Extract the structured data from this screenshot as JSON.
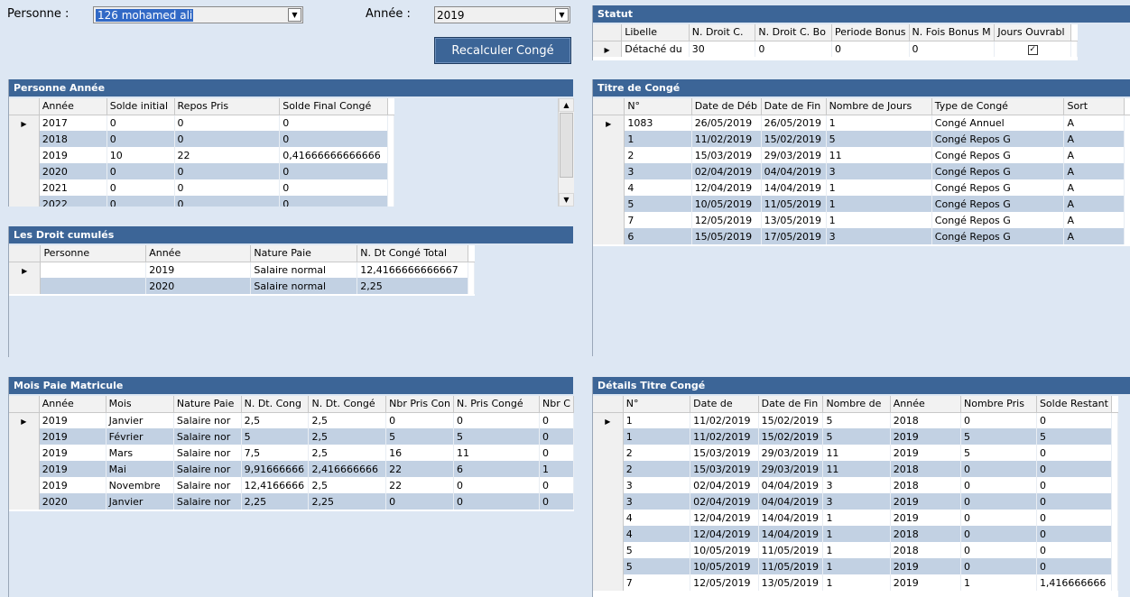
{
  "filters": {
    "personne_label": "Personne :",
    "personne_value": "126 mohamed ali",
    "annee_label": "Année :",
    "annee_value": "2019",
    "recalc_label": "Recalculer Congé"
  },
  "statut": {
    "title": "Statut",
    "columns": [
      "Libelle",
      "N. Droit C.",
      "N. Droit C. Bo",
      "Periode Bonus",
      "N. Fois Bonus M",
      "Jours Ouvrabl"
    ],
    "rows": [
      [
        "Détaché du",
        "30",
        "0",
        "0",
        "0",
        "checked"
      ]
    ]
  },
  "personne_annee": {
    "title": "Personne Année",
    "columns": [
      "Année",
      "Solde initial",
      "Repos Pris",
      "Solde Final Congé"
    ],
    "rows": [
      [
        "2017",
        "0",
        "0",
        "0"
      ],
      [
        "2018",
        "0",
        "0",
        "0"
      ],
      [
        "2019",
        "10",
        "22",
        "0,41666666666666"
      ],
      [
        "2020",
        "0",
        "0",
        "0"
      ],
      [
        "2021",
        "0",
        "0",
        "0"
      ],
      [
        "2022",
        "0",
        "0",
        "0"
      ]
    ]
  },
  "titre_conge": {
    "title": "Titre de Congé",
    "columns": [
      "N°",
      "Date de Déb",
      "Date de Fin",
      "Nombre de Jours",
      "Type de Congé",
      "Sort"
    ],
    "rows": [
      [
        "1083",
        "26/05/2019",
        "26/05/2019",
        "1",
        "Congé Annuel",
        "A"
      ],
      [
        "1",
        "11/02/2019",
        "15/02/2019",
        "5",
        "Congé Repos G",
        "A"
      ],
      [
        "2",
        "15/03/2019",
        "29/03/2019",
        "11",
        "Congé Repos G",
        "A"
      ],
      [
        "3",
        "02/04/2019",
        "04/04/2019",
        "3",
        "Congé Repos G",
        "A"
      ],
      [
        "4",
        "12/04/2019",
        "14/04/2019",
        "1",
        "Congé Repos G",
        "A"
      ],
      [
        "5",
        "10/05/2019",
        "11/05/2019",
        "1",
        "Congé Repos G",
        "A"
      ],
      [
        "7",
        "12/05/2019",
        "13/05/2019",
        "1",
        "Congé Repos G",
        "A"
      ],
      [
        "6",
        "15/05/2019",
        "17/05/2019",
        "3",
        "Congé Repos G",
        "A"
      ]
    ]
  },
  "droit_cumules": {
    "title": "Les Droit cumulés",
    "columns": [
      "Personne",
      "Année",
      "Nature Paie",
      "N. Dt Congé Total"
    ],
    "rows": [
      [
        "",
        "2019",
        "Salaire normal",
        "12,4166666666667"
      ],
      [
        "",
        "2020",
        "Salaire normal",
        "2,25"
      ]
    ]
  },
  "mois_paie": {
    "title": "Mois Paie Matricule",
    "columns": [
      "Année",
      "Mois",
      "Nature Paie",
      "N. Dt. Cong",
      "N. Dt. Congé",
      "Nbr Pris Con",
      "N. Pris Congé",
      "Nbr C"
    ],
    "rows": [
      [
        "2019",
        "Janvier",
        "Salaire nor",
        "2,5",
        "2,5",
        "0",
        "0",
        "0"
      ],
      [
        "2019",
        "Février",
        "Salaire nor",
        "5",
        "2,5",
        "5",
        "5",
        "0"
      ],
      [
        "2019",
        "Mars",
        "Salaire nor",
        "7,5",
        "2,5",
        "16",
        "11",
        "0"
      ],
      [
        "2019",
        "Mai",
        "Salaire nor",
        "9,91666666",
        "2,416666666",
        "22",
        "6",
        "1"
      ],
      [
        "2019",
        "Novembre",
        "Salaire nor",
        "12,4166666",
        "2,5",
        "22",
        "0",
        "0"
      ],
      [
        "2020",
        "Janvier",
        "Salaire nor",
        "2,25",
        "2,25",
        "0",
        "0",
        "0"
      ]
    ]
  },
  "details_titre": {
    "title": "Détails Titre Congé",
    "columns": [
      "N°",
      "Date de",
      "Date de Fin",
      "Nombre de",
      "Année",
      "Nombre Pris",
      "Solde Restant"
    ],
    "rows": [
      [
        "1",
        "11/02/2019",
        "15/02/2019",
        "5",
        "2018",
        "0",
        "0"
      ],
      [
        "1",
        "11/02/2019",
        "15/02/2019",
        "5",
        "2019",
        "5",
        "5"
      ],
      [
        "2",
        "15/03/2019",
        "29/03/2019",
        "11",
        "2019",
        "5",
        "0"
      ],
      [
        "2",
        "15/03/2019",
        "29/03/2019",
        "11",
        "2018",
        "0",
        "0"
      ],
      [
        "3",
        "02/04/2019",
        "04/04/2019",
        "3",
        "2018",
        "0",
        "0"
      ],
      [
        "3",
        "02/04/2019",
        "04/04/2019",
        "3",
        "2019",
        "0",
        "0"
      ],
      [
        "4",
        "12/04/2019",
        "14/04/2019",
        "1",
        "2019",
        "0",
        "0"
      ],
      [
        "4",
        "12/04/2019",
        "14/04/2019",
        "1",
        "2018",
        "0",
        "0"
      ],
      [
        "5",
        "10/05/2019",
        "11/05/2019",
        "1",
        "2018",
        "0",
        "0"
      ],
      [
        "5",
        "10/05/2019",
        "11/05/2019",
        "1",
        "2019",
        "0",
        "0"
      ],
      [
        "7",
        "12/05/2019",
        "13/05/2019",
        "1",
        "2019",
        "1",
        "1,416666666"
      ]
    ]
  },
  "colors": {
    "header_blue": "#3c6597",
    "alt_row": "#c2d1e3",
    "background": "#dde7f3"
  },
  "icons": {
    "row_pointer": "triangle-right",
    "dropdown": "chevron-down",
    "scroll_up": "triangle-up",
    "scroll_down": "triangle-down"
  }
}
